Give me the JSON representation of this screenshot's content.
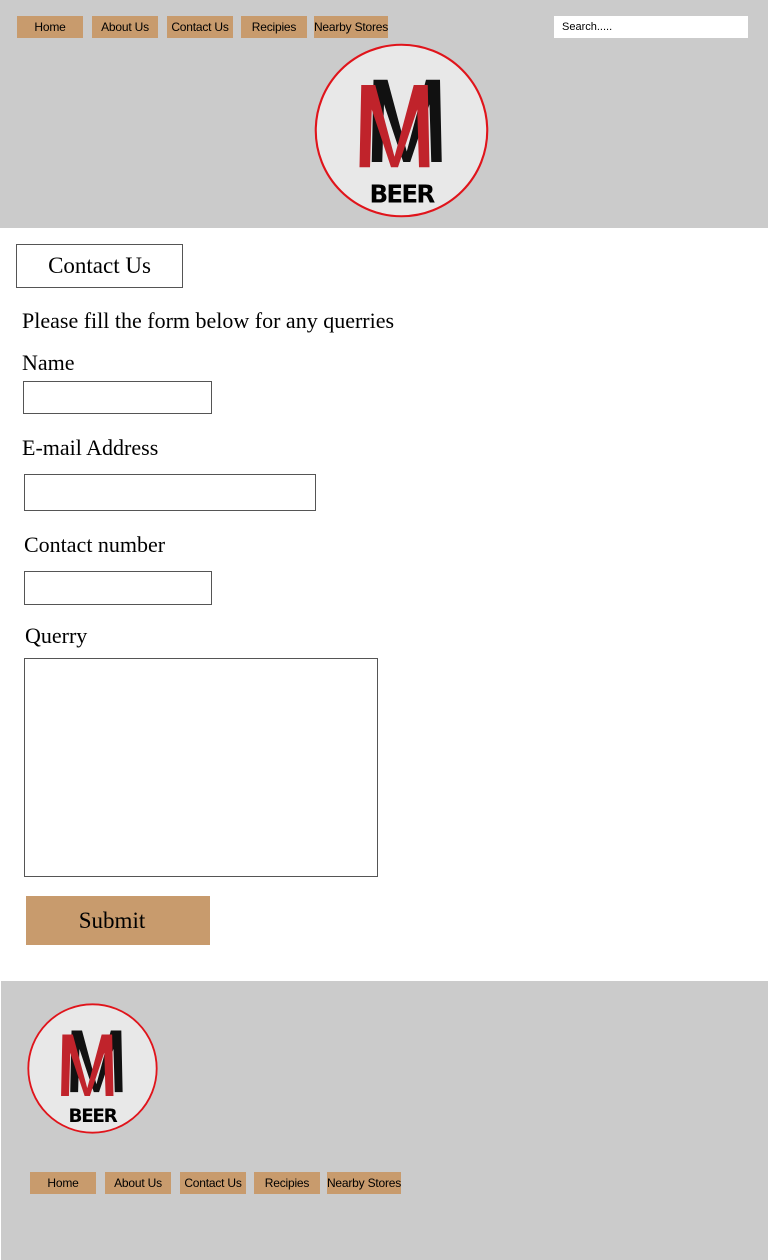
{
  "nav": {
    "items": [
      "Home",
      "About Us",
      "Contact Us",
      "Recipies",
      "Nearby Stores"
    ]
  },
  "search": {
    "placeholder": "Search....."
  },
  "logo": {
    "letter": "M",
    "word": "BEER"
  },
  "main": {
    "title": "Contact Us",
    "intro": "Please fill the form below for any querries",
    "name_label": "Name",
    "email_label": "E-mail Address",
    "contact_label": "Contact number",
    "querry_label": "Querry",
    "submit_label": "Submit"
  },
  "footer": {
    "nav_items": [
      "Home",
      "About Us",
      "Contact Us",
      "Recipies",
      "Nearby Stores"
    ]
  },
  "colors": {
    "header_bg": "#cbcbcb",
    "button_bg": "#c89b6d",
    "logo_ring": "#e0141b",
    "logo_red": "#c0232b"
  }
}
